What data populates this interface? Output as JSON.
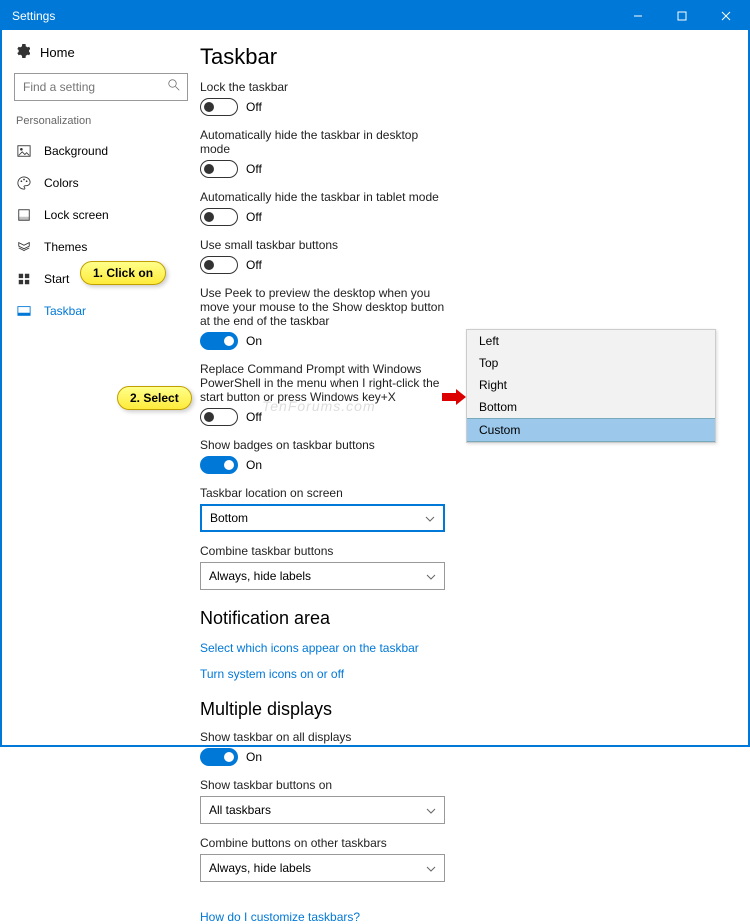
{
  "titlebar": {
    "title": "Settings"
  },
  "sidebar": {
    "home": "Home",
    "search_placeholder": "Find a setting",
    "category": "Personalization",
    "items": [
      {
        "label": "Background"
      },
      {
        "label": "Colors"
      },
      {
        "label": "Lock screen"
      },
      {
        "label": "Themes"
      },
      {
        "label": "Start"
      },
      {
        "label": "Taskbar"
      }
    ]
  },
  "page": {
    "heading": "Taskbar",
    "settings": {
      "lock": {
        "label": "Lock the taskbar",
        "state": "Off"
      },
      "autohide_desktop": {
        "label": "Automatically hide the taskbar in desktop mode",
        "state": "Off"
      },
      "autohide_tablet": {
        "label": "Automatically hide the taskbar in tablet mode",
        "state": "Off"
      },
      "small_buttons": {
        "label": "Use small taskbar buttons",
        "state": "Off"
      },
      "peek": {
        "label": "Use Peek to preview the desktop when you move your mouse to the Show desktop button at the end of the taskbar",
        "state": "On"
      },
      "powershell": {
        "label": "Replace Command Prompt with Windows PowerShell in the menu when I right-click the start button or press Windows key+X",
        "state": "Off"
      },
      "badges": {
        "label": "Show badges on taskbar buttons",
        "state": "On"
      },
      "location": {
        "label": "Taskbar location on screen",
        "value": "Bottom"
      },
      "combine": {
        "label": "Combine taskbar buttons",
        "value": "Always, hide labels"
      }
    },
    "notif_heading": "Notification area",
    "notif_link1": "Select which icons appear on the taskbar",
    "notif_link2": "Turn system icons on or off",
    "multi_heading": "Multiple displays",
    "multi": {
      "show_all": {
        "label": "Show taskbar on all displays",
        "state": "On"
      },
      "buttons_on": {
        "label": "Show taskbar buttons on",
        "value": "All taskbars"
      },
      "combine_other": {
        "label": "Combine buttons on other taskbars",
        "value": "Always, hide labels"
      }
    },
    "footer_link": "How do I customize taskbars?"
  },
  "callouts": {
    "c1": "1. Click on",
    "c2": "2. Select"
  },
  "popup": {
    "items": [
      "Left",
      "Top",
      "Right",
      "Bottom",
      "Custom"
    ],
    "selected": "Custom"
  },
  "watermark": "TenForums.com"
}
